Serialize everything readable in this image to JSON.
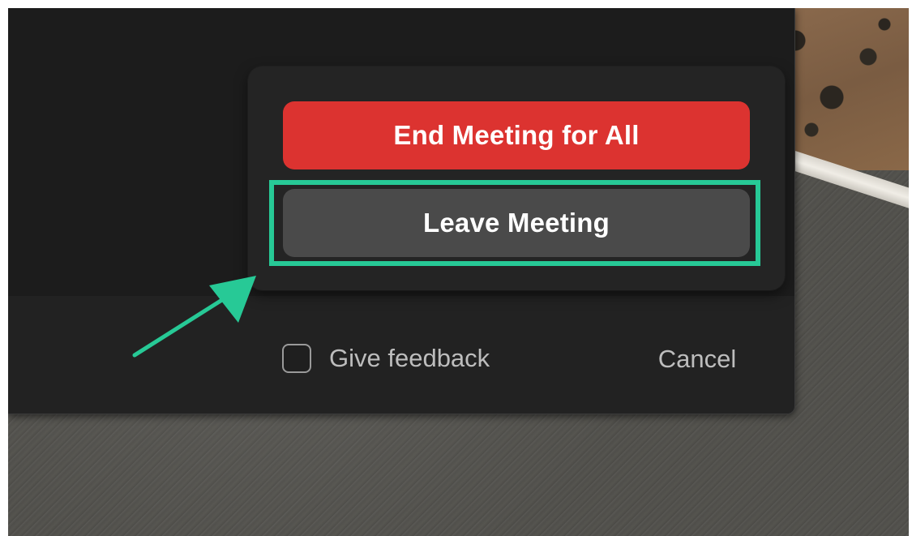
{
  "leave_dialog": {
    "end_all_label": "End Meeting for All",
    "leave_label": "Leave Meeting",
    "feedback_label": "Give feedback",
    "feedback_checked": false,
    "cancel_label": "Cancel"
  },
  "colors": {
    "end_button": "#dc3330",
    "leave_button": "#4a4a4a",
    "highlight": "#27c996",
    "window_bg": "#222222"
  },
  "icons": {
    "annotation": "arrow-icon",
    "checkbox": "checkbox-icon"
  }
}
